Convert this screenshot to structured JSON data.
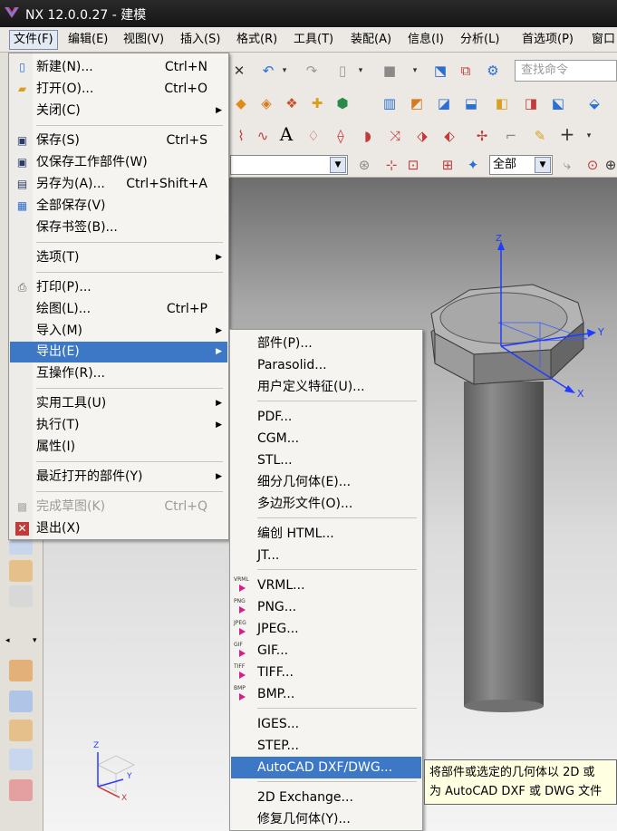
{
  "window": {
    "title": "NX 12.0.0.27 - 建模"
  },
  "menubar": {
    "items": [
      "文件(F)",
      "编辑(E)",
      "视图(V)",
      "插入(S)",
      "格式(R)",
      "工具(T)",
      "装配(A)",
      "信息(I)",
      "分析(L)",
      "首选项(P)",
      "窗口"
    ],
    "active": "文件(F)"
  },
  "toolbar": {
    "search_placeholder": "查找命令",
    "selection_filter": "全部"
  },
  "file_menu": {
    "items": [
      {
        "label": "新建(N)...",
        "shortcut": "Ctrl+N"
      },
      {
        "label": "打开(O)...",
        "shortcut": "Ctrl+O"
      },
      {
        "label": "关闭(C)",
        "submenu": true
      },
      {
        "label": "保存(S)",
        "shortcut": "Ctrl+S"
      },
      {
        "label": "仅保存工作部件(W)"
      },
      {
        "label": "另存为(A)...",
        "shortcut": "Ctrl+Shift+A"
      },
      {
        "label": "全部保存(V)"
      },
      {
        "label": "保存书签(B)..."
      },
      {
        "label": "选项(T)",
        "submenu": true
      },
      {
        "label": "打印(P)..."
      },
      {
        "label": "绘图(L)...",
        "shortcut": "Ctrl+P"
      },
      {
        "label": "导入(M)",
        "submenu": true
      },
      {
        "label": "导出(E)",
        "submenu": true,
        "highlighted": true
      },
      {
        "label": "互操作(R)..."
      },
      {
        "label": "实用工具(U)",
        "submenu": true
      },
      {
        "label": "执行(T)",
        "submenu": true
      },
      {
        "label": "属性(I)"
      },
      {
        "label": "最近打开的部件(Y)",
        "submenu": true
      },
      {
        "label": "完成草图(K)",
        "shortcut": "Ctrl+Q",
        "disabled": true
      },
      {
        "label": "退出(X)"
      }
    ]
  },
  "export_menu": {
    "items": [
      {
        "label": "部件(P)..."
      },
      {
        "label": "Parasolid..."
      },
      {
        "label": "用户定义特征(U)..."
      },
      {
        "label": "PDF..."
      },
      {
        "label": "CGM..."
      },
      {
        "label": "STL..."
      },
      {
        "label": "细分几何体(E)..."
      },
      {
        "label": "多边形文件(O)..."
      },
      {
        "label": "编创 HTML..."
      },
      {
        "label": "JT..."
      },
      {
        "label": "VRML...",
        "icon_text": "VRML"
      },
      {
        "label": "PNG...",
        "icon_text": "PNG"
      },
      {
        "label": "JPEG...",
        "icon_text": "JPEG"
      },
      {
        "label": "GIF...",
        "icon_text": "GIF"
      },
      {
        "label": "TIFF...",
        "icon_text": "TIFF"
      },
      {
        "label": "BMP...",
        "icon_text": "BMP"
      },
      {
        "label": "IGES..."
      },
      {
        "label": "STEP..."
      },
      {
        "label": "AutoCAD DXF/DWG...",
        "highlighted": true
      },
      {
        "label": "2D Exchange..."
      },
      {
        "label": "修复几何体(Y)..."
      }
    ]
  },
  "tooltip": {
    "line1": "将部件或选定的几何体以 2D 或",
    "line2": "为 AutoCAD DXF 或 DWG 文件"
  },
  "triad": {
    "x": "X",
    "y": "Y",
    "z": "Z"
  },
  "colors": {
    "highlight": "#3d78c6",
    "titlebar": "#1e1e1e",
    "axis_blue": "#1f3cff"
  }
}
